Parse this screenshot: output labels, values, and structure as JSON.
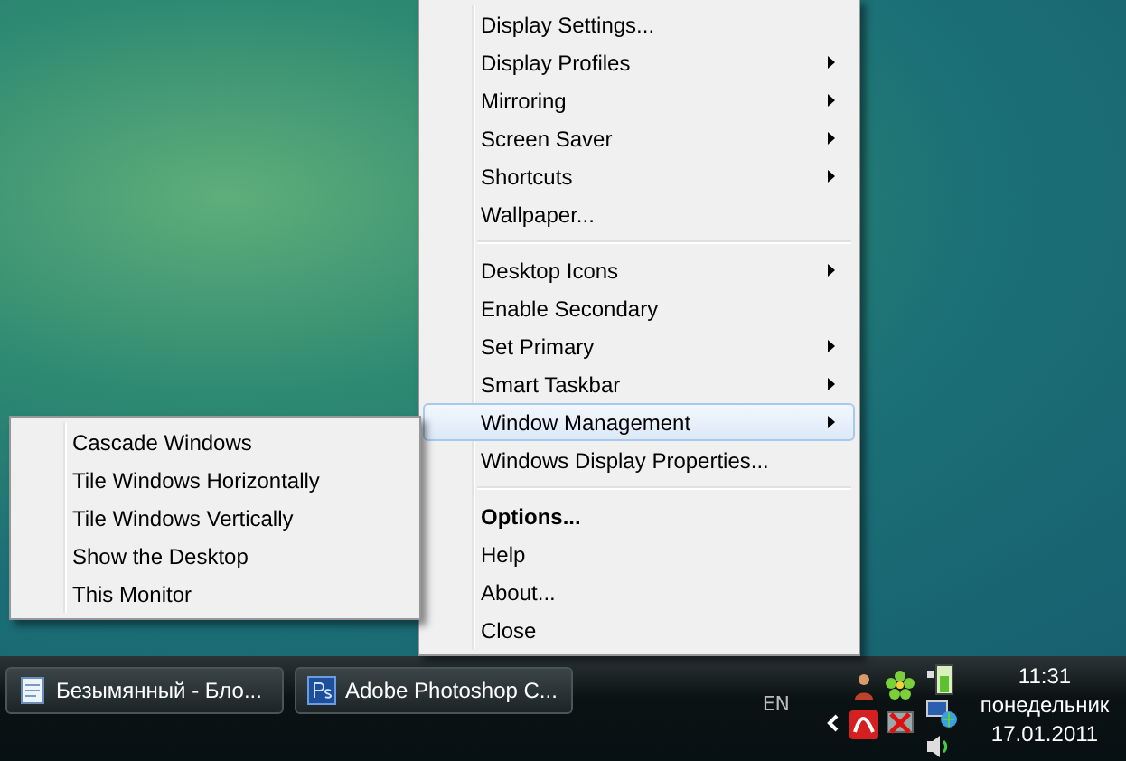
{
  "context_menu": {
    "items": [
      {
        "kind": "item",
        "label": "Display Settings...",
        "submenu": false,
        "selected": false
      },
      {
        "kind": "item",
        "label": "Display Profiles",
        "submenu": true,
        "selected": false
      },
      {
        "kind": "item",
        "label": "Mirroring",
        "submenu": true,
        "selected": false
      },
      {
        "kind": "item",
        "label": "Screen Saver",
        "submenu": true,
        "selected": false
      },
      {
        "kind": "item",
        "label": "Shortcuts",
        "submenu": true,
        "selected": false
      },
      {
        "kind": "item",
        "label": "Wallpaper...",
        "submenu": false,
        "selected": false
      },
      {
        "kind": "separator"
      },
      {
        "kind": "item",
        "label": "Desktop Icons",
        "submenu": true,
        "selected": false
      },
      {
        "kind": "item",
        "label": "Enable Secondary",
        "submenu": false,
        "selected": false
      },
      {
        "kind": "item",
        "label": "Set Primary",
        "submenu": true,
        "selected": false
      },
      {
        "kind": "item",
        "label": "Smart Taskbar",
        "submenu": true,
        "selected": false
      },
      {
        "kind": "item",
        "label": "Window Management",
        "submenu": true,
        "selected": true
      },
      {
        "kind": "item",
        "label": "Windows Display Properties...",
        "submenu": false,
        "selected": false
      },
      {
        "kind": "separator"
      },
      {
        "kind": "item",
        "label": "Options...",
        "submenu": false,
        "selected": false,
        "bold": true
      },
      {
        "kind": "item",
        "label": "Help",
        "submenu": false,
        "selected": false
      },
      {
        "kind": "item",
        "label": "About...",
        "submenu": false,
        "selected": false
      },
      {
        "kind": "item",
        "label": "Close",
        "submenu": false,
        "selected": false
      }
    ]
  },
  "submenu": {
    "items": [
      {
        "label": "Cascade Windows",
        "selected": false
      },
      {
        "label": "Tile Windows Horizontally",
        "selected": false
      },
      {
        "label": "Tile Windows Vertically",
        "selected": false
      },
      {
        "label": "Show the Desktop",
        "selected": false
      },
      {
        "label": "This Monitor",
        "selected": false
      }
    ]
  },
  "taskbar": {
    "buttons": [
      {
        "kind": "notepad",
        "label": "Безымянный - Бло..."
      },
      {
        "kind": "photoshop",
        "label": "Adobe Photoshop C..."
      }
    ],
    "language": "EN",
    "clock": {
      "time": "11:31",
      "day": "понедельник",
      "date": "17.01.2011"
    }
  }
}
